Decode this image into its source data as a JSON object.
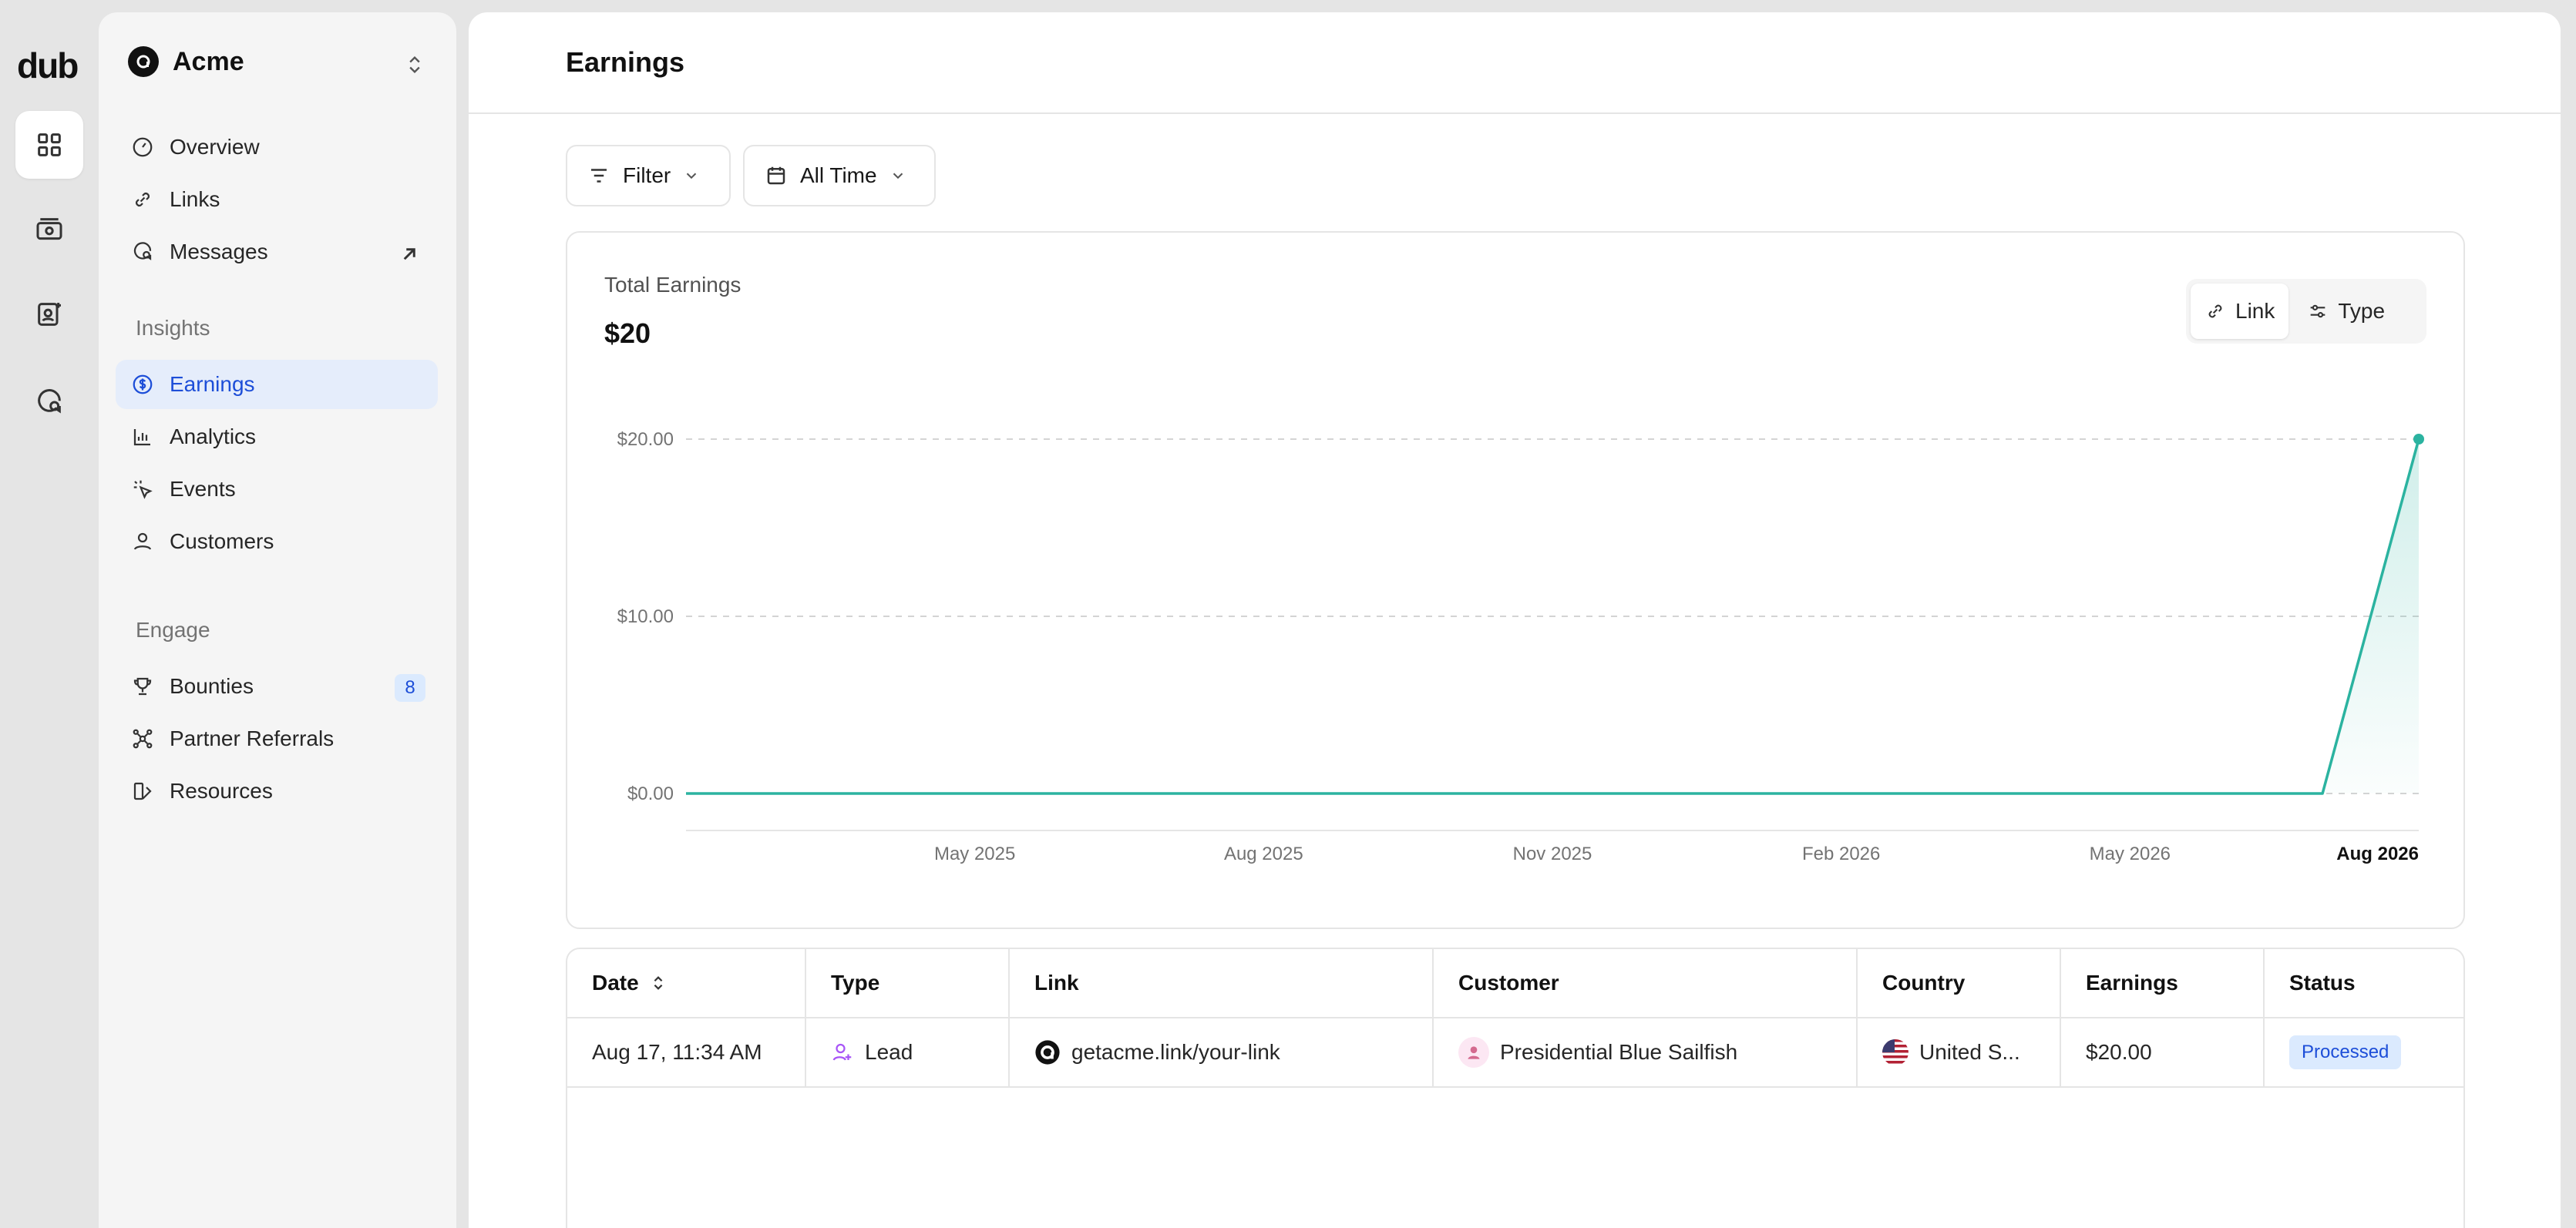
{
  "brand": {
    "logo_text": "dub"
  },
  "workspace": {
    "name": "Acme"
  },
  "nav": {
    "overview": "Overview",
    "links": "Links",
    "messages": "Messages",
    "insights_label": "Insights",
    "earnings": "Earnings",
    "analytics": "Analytics",
    "events": "Events",
    "customers": "Customers",
    "engage_label": "Engage",
    "bounties": "Bounties",
    "bounties_count": "8",
    "partner_referrals": "Partner Referrals",
    "resources": "Resources"
  },
  "page": {
    "title": "Earnings"
  },
  "controls": {
    "filter_label": "Filter",
    "range_label": "All Time"
  },
  "summary": {
    "total_label": "Total Earnings",
    "total_value": "$20"
  },
  "toggle": {
    "link_label": "Link",
    "type_label": "Type",
    "active": "Link"
  },
  "chart_data": {
    "type": "area",
    "x": [
      "2025-02",
      "2025-03",
      "2025-04",
      "2025-05",
      "2025-06",
      "2025-07",
      "2025-08",
      "2025-09",
      "2025-10",
      "2025-11",
      "2025-12",
      "2026-01",
      "2026-02",
      "2026-03",
      "2026-04",
      "2026-05",
      "2026-06",
      "2026-07",
      "2026-08"
    ],
    "series": [
      {
        "values": [
          0,
          0,
          0,
          0,
          0,
          0,
          0,
          0,
          0,
          0,
          0,
          0,
          0,
          0,
          0,
          0,
          0,
          0,
          20
        ]
      }
    ],
    "x_ticks": [
      {
        "label": "May 2025",
        "x": "2025-05"
      },
      {
        "label": "Aug 2025",
        "x": "2025-08"
      },
      {
        "label": "Nov 2025",
        "x": "2025-11"
      },
      {
        "label": "Feb 2026",
        "x": "2026-02"
      },
      {
        "label": "May 2026",
        "x": "2026-05"
      },
      {
        "label": "Aug 2026",
        "x": "2026-08"
      }
    ],
    "y_ticks": [
      {
        "label": "$0.00",
        "value": 0
      },
      {
        "label": "$10.00",
        "value": 10
      },
      {
        "label": "$20.00",
        "value": 20
      }
    ],
    "ylim": [
      0,
      20
    ],
    "grid": true,
    "colors": {
      "line": "#2bb3a0",
      "fill": "#2bb3a0"
    }
  },
  "table": {
    "columns": [
      "Date",
      "Type",
      "Link",
      "Customer",
      "Country",
      "Earnings",
      "Status"
    ],
    "rows": [
      {
        "date": "Aug 17, 11:34 AM",
        "type": "Lead",
        "link": "getacme.link/your-link",
        "customer": "Presidential Blue Sailfish",
        "country": "United S...",
        "earnings": "$20.00",
        "status": "Processed"
      }
    ]
  }
}
